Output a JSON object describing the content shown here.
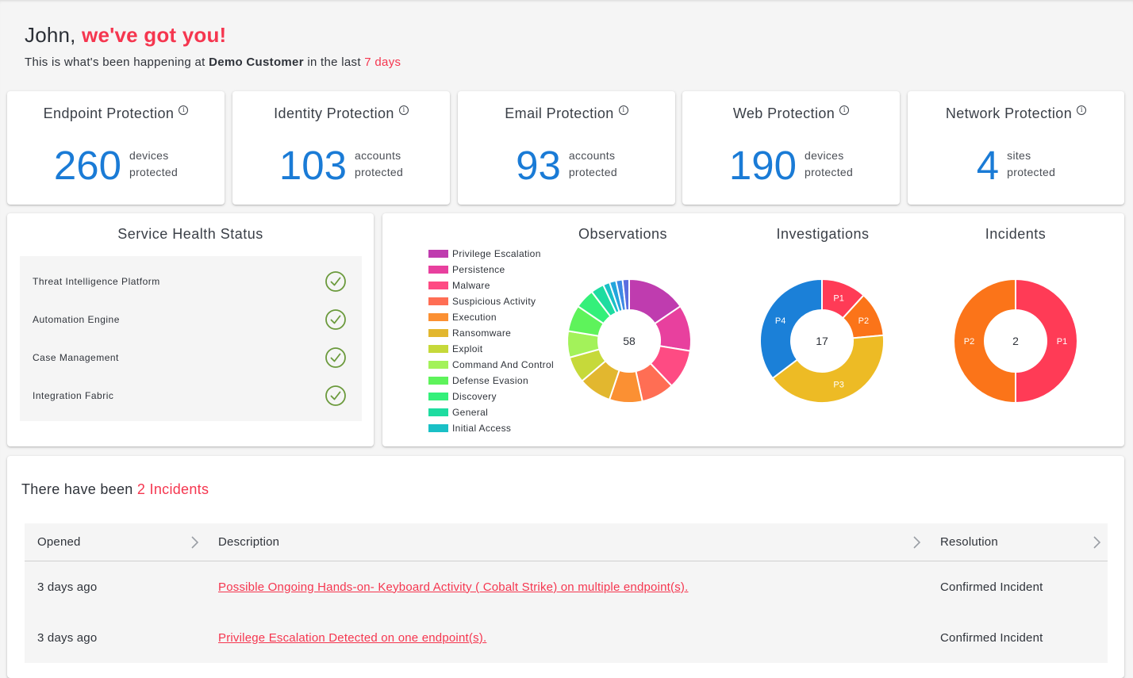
{
  "greeting": {
    "name": "John,",
    "tagline": "we've got you!"
  },
  "summary": {
    "prefix": "This is what's been happening at",
    "customer": "Demo Customer",
    "middle": "in the last",
    "period": "7 days"
  },
  "protection_cards": [
    {
      "title": "Endpoint Protection",
      "value": "260",
      "unit_line1": "devices",
      "unit_line2": "protected"
    },
    {
      "title": "Identity Protection",
      "value": "103",
      "unit_line1": "accounts",
      "unit_line2": "protected"
    },
    {
      "title": "Email Protection",
      "value": "93",
      "unit_line1": "accounts",
      "unit_line2": "protected"
    },
    {
      "title": "Web Protection",
      "value": "190",
      "unit_line1": "devices",
      "unit_line2": "protected"
    },
    {
      "title": "Network Protection",
      "value": "4",
      "unit_line1": "sites",
      "unit_line2": "protected"
    }
  ],
  "icons": {
    "info": "i",
    "status_ok": "check-circle-icon",
    "sort": "chevron-right-icon"
  },
  "service_health": {
    "title": "Service Health Status",
    "items": [
      {
        "name": "Threat Intelligence Platform",
        "status": "ok"
      },
      {
        "name": "Automation Engine",
        "status": "ok"
      },
      {
        "name": "Case Management",
        "status": "ok"
      },
      {
        "name": "Integration Fabric",
        "status": "ok"
      }
    ]
  },
  "chart_data": [
    {
      "type": "pie",
      "style": "donut",
      "title": "Observations",
      "center_label": "58",
      "total": 58,
      "legend_placement": "left",
      "categories": [
        "Privilege Escalation",
        "Persistence",
        "Malware",
        "Suspicious Activity",
        "Execution",
        "Ransomware",
        "Exploit",
        "Command And Control",
        "Defense Evasion",
        "Discovery",
        "General",
        "Initial Access",
        null,
        null,
        null
      ],
      "values": [
        9,
        7,
        6,
        5,
        5,
        5,
        4,
        4,
        4,
        3,
        2,
        1,
        1,
        1,
        1
      ],
      "colors": [
        "#bf3caf",
        "#e8409e",
        "#fe4b83",
        "#ff6e54",
        "#fb9033",
        "#e2b72f",
        "#c6d93a",
        "#a3f25a",
        "#5ef35b",
        "#34f07a",
        "#1edca0",
        "#1ac0c6",
        "#23a5dc",
        "#3e89e4",
        "#5a6ee0"
      ],
      "data_labels": []
    },
    {
      "type": "pie",
      "style": "donut",
      "title": "Investigations",
      "center_label": "17",
      "total": 17,
      "categories": [
        "P1",
        "P2",
        "P3",
        "P4"
      ],
      "values": [
        2,
        2,
        7,
        6
      ],
      "colors": [
        "#ff3b56",
        "#fb7419",
        "#edbb25",
        "#1b80d8"
      ],
      "data_labels": [
        "P1",
        "P2",
        "P3",
        "P4"
      ]
    },
    {
      "type": "pie",
      "style": "donut",
      "title": "Incidents",
      "center_label": "2",
      "total": 2,
      "categories": [
        "P1",
        "P2"
      ],
      "values": [
        1,
        1
      ],
      "colors": [
        "#ff3b56",
        "#fb7419"
      ],
      "data_labels": [
        "P1",
        "P2"
      ]
    }
  ],
  "incidents_summary": {
    "prefix": "There have been",
    "count_text": "2 Incidents"
  },
  "incidents_table": {
    "columns": [
      "Opened",
      "Description",
      "Resolution"
    ],
    "rows": [
      {
        "opened": "3 days ago",
        "description": "Possible Ongoing Hands-on- Keyboard Activity ( Cobalt Strike) on multiple endpoint(s).",
        "resolution": "Confirmed Incident"
      },
      {
        "opened": "3 days ago",
        "description": "Privilege Escalation Detected on one endpoint(s).",
        "resolution": "Confirmed Incident"
      }
    ]
  },
  "colors": {
    "accent_red": "#f5364f",
    "metric_blue": "#1a7bd6",
    "status_ok_green": "#6b9a3c"
  }
}
